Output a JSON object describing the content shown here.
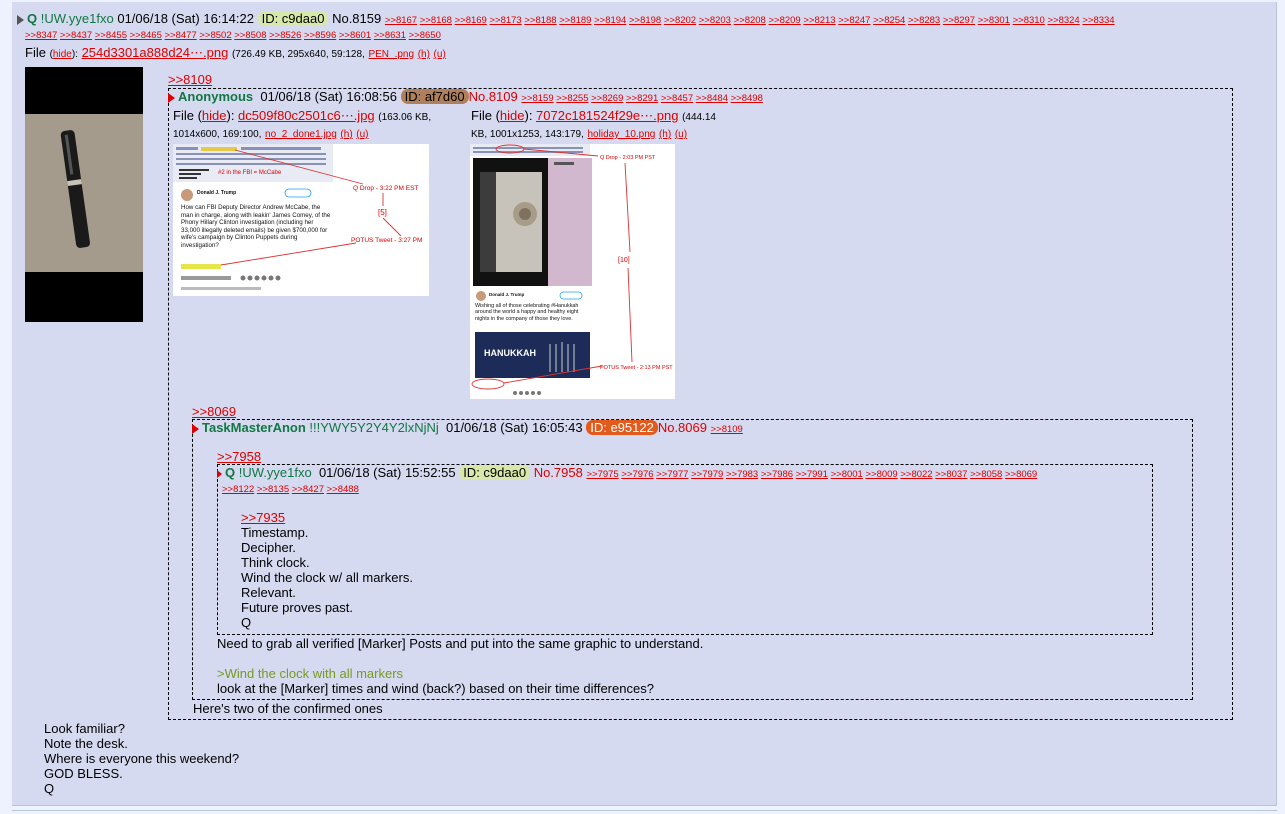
{
  "main_post": {
    "name": "Q",
    "trip": "!UW.yye1fxo",
    "datetime": "01/06/18 (Sat) 16:14:22",
    "id_label": "ID: c9daa0",
    "id_color": "#d8e8a8",
    "number": "No.8159",
    "backlinks_row1": [
      ">>8167",
      ">>8168",
      ">>8169",
      ">>8173",
      ">>8188",
      ">>8189",
      ">>8194",
      ">>8198",
      ">>8202",
      ">>8203",
      ">>8208",
      ">>8209",
      ">>8213",
      ">>8247",
      ">>8254",
      ">>8283",
      ">>8297",
      ">>8301",
      ">>8310",
      ">>8324",
      ">>8334"
    ],
    "backlinks_row2": [
      ">>8347",
      ">>8437",
      ">>8455",
      ">>8465",
      ">>8477",
      ">>8502",
      ">>8508",
      ">>8526",
      ">>8596",
      ">>8601",
      ">>8631",
      ">>8650"
    ],
    "file": {
      "label": "File",
      "hide": "hide",
      "name": "254d3301a888d24⋯.png",
      "meta": "(726.49 KB, 295x640, 59:128,",
      "orig": "PEN_.png",
      "h": "(h)",
      "u": "(u)"
    },
    "body": [
      "Look familiar?",
      "Note the desk.",
      "Where is everyone this weekend?",
      "GOD BLESS.",
      "Q"
    ]
  },
  "quote_8109": {
    "link": ">>8109",
    "name": "Anonymous",
    "datetime": "01/06/18 (Sat) 16:08:56",
    "id_label": "ID: af7d60",
    "id_color": "#b0805a",
    "number": "No.8109",
    "backlinks": [
      ">>8159",
      ">>8255",
      ">>8269",
      ">>8291",
      ">>8457",
      ">>8484",
      ">>8498"
    ],
    "file1": {
      "label": "File",
      "hide": "hide",
      "name": "dc509f80c2501c6⋯.jpg",
      "meta1": "(163.06 KB,",
      "meta2": "1014x600, 169:100,",
      "orig": "no_2_done1.jpg",
      "h": "(h)",
      "u": "(u)"
    },
    "file2": {
      "label": "File",
      "hide": "hide",
      "name": "7072c181524f29e⋯.png",
      "meta1": "(444.14",
      "meta2": "KB, 1001x1253, 143:179,",
      "orig": "holiday_10.png",
      "h": "(h)",
      "u": "(u)"
    },
    "thumb1": {
      "drop_label": "Q Drop - 3:22 PM EST",
      "count_label": "[5]",
      "tweet_label": "POTUS Tweet - 3:27 PM",
      "fbi_note": "#2 in the FBI = McCabe",
      "tweet_author": "Donald J. Trump",
      "tweet_text": "How can FBI Deputy Director Andrew McCabe, the man in charge, along with leakin' James Comey, of the Phony Hillary Clinton investigation (including her 33,000 illegally deleted emails) be given $700,000 for wife's campaign by Clinton Puppets during investigation?"
    },
    "thumb2": {
      "drop_label": "Q Drop - 2:03 PM PST",
      "count_label": "[10]",
      "tweet_label": "POTUS Tweet - 2:13 PM PST",
      "tweet_author": "Donald J. Trump",
      "tweet_text": "Wishing all of those celebrating #Hanukkah around the world a happy and healthy eight nights in the company of those they love.",
      "banner": "HANUKKAH"
    },
    "body_last": "Here's two of the confirmed ones"
  },
  "quote_8069": {
    "link": ">>8069",
    "name": "TaskMasterAnon",
    "trip": "!!!YWY5Y2Y4Y2lxNjNj",
    "datetime": "01/06/18 (Sat) 16:05:43",
    "id_label": "ID: e95122",
    "id_color": "#e25a1c",
    "number": "No.8069",
    "backlinks": [
      ">>8109"
    ],
    "body1": "Need to grab all verified [Marker] Posts and put into the same graphic to understand.",
    "greentext": ">Wind the clock with all markers",
    "body2": "look at the [Marker] times and wind (back?) based on their time differences?"
  },
  "quote_7958": {
    "link": ">>7958",
    "name": "Q",
    "trip": "!UW.yye1fxo",
    "datetime": "01/06/18 (Sat) 15:52:55",
    "id_label": "ID: c9daa0",
    "id_color": "#d8e8a8",
    "number": "No.7958",
    "backlinks_row1": [
      ">>7975",
      ">>7976",
      ">>7977",
      ">>7979",
      ">>7983",
      ">>7986",
      ">>7991",
      ">>8001",
      ">>8009",
      ">>8022",
      ">>8037",
      ">>8058",
      ">>8069"
    ],
    "backlinks_row2": [
      ">>8122",
      ">>8135",
      ">>8427",
      ">>8488"
    ],
    "quote_link": ">>7935",
    "body": [
      "Timestamp.",
      "Decipher.",
      "Think clock.",
      "Wind the clock w/ all markers.",
      "Relevant.",
      "Future proves past.",
      "Q"
    ]
  }
}
